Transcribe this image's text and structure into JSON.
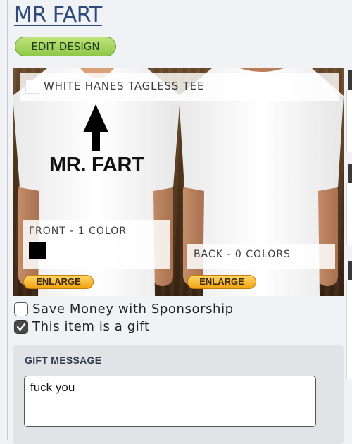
{
  "header": {
    "title": "MR FART",
    "edit_label": "EDIT DESIGN"
  },
  "product": {
    "style_name": "WHITE HANES TAGLESS TEE",
    "shirt_color": "#ffffff",
    "print_text": "MR. FART",
    "front_label": "FRONT - 1 COLOR",
    "front_color": "#000000",
    "back_label": "BACK - 0 COLORS",
    "enlarge_front_label": "ENLARGE",
    "enlarge_back_label": "ENLARGE"
  },
  "options": {
    "sponsorship_label": "Save Money with Sponsorship",
    "sponsorship_checked": false,
    "gift_label": "This item is a gift",
    "gift_checked": true
  },
  "gift_message": {
    "heading": "GIFT MESSAGE",
    "value": "fuck you"
  },
  "colors": {
    "title": "#2d4a78",
    "edit_button": "#a6d55e",
    "enlarge_button": "#f5b12a"
  }
}
